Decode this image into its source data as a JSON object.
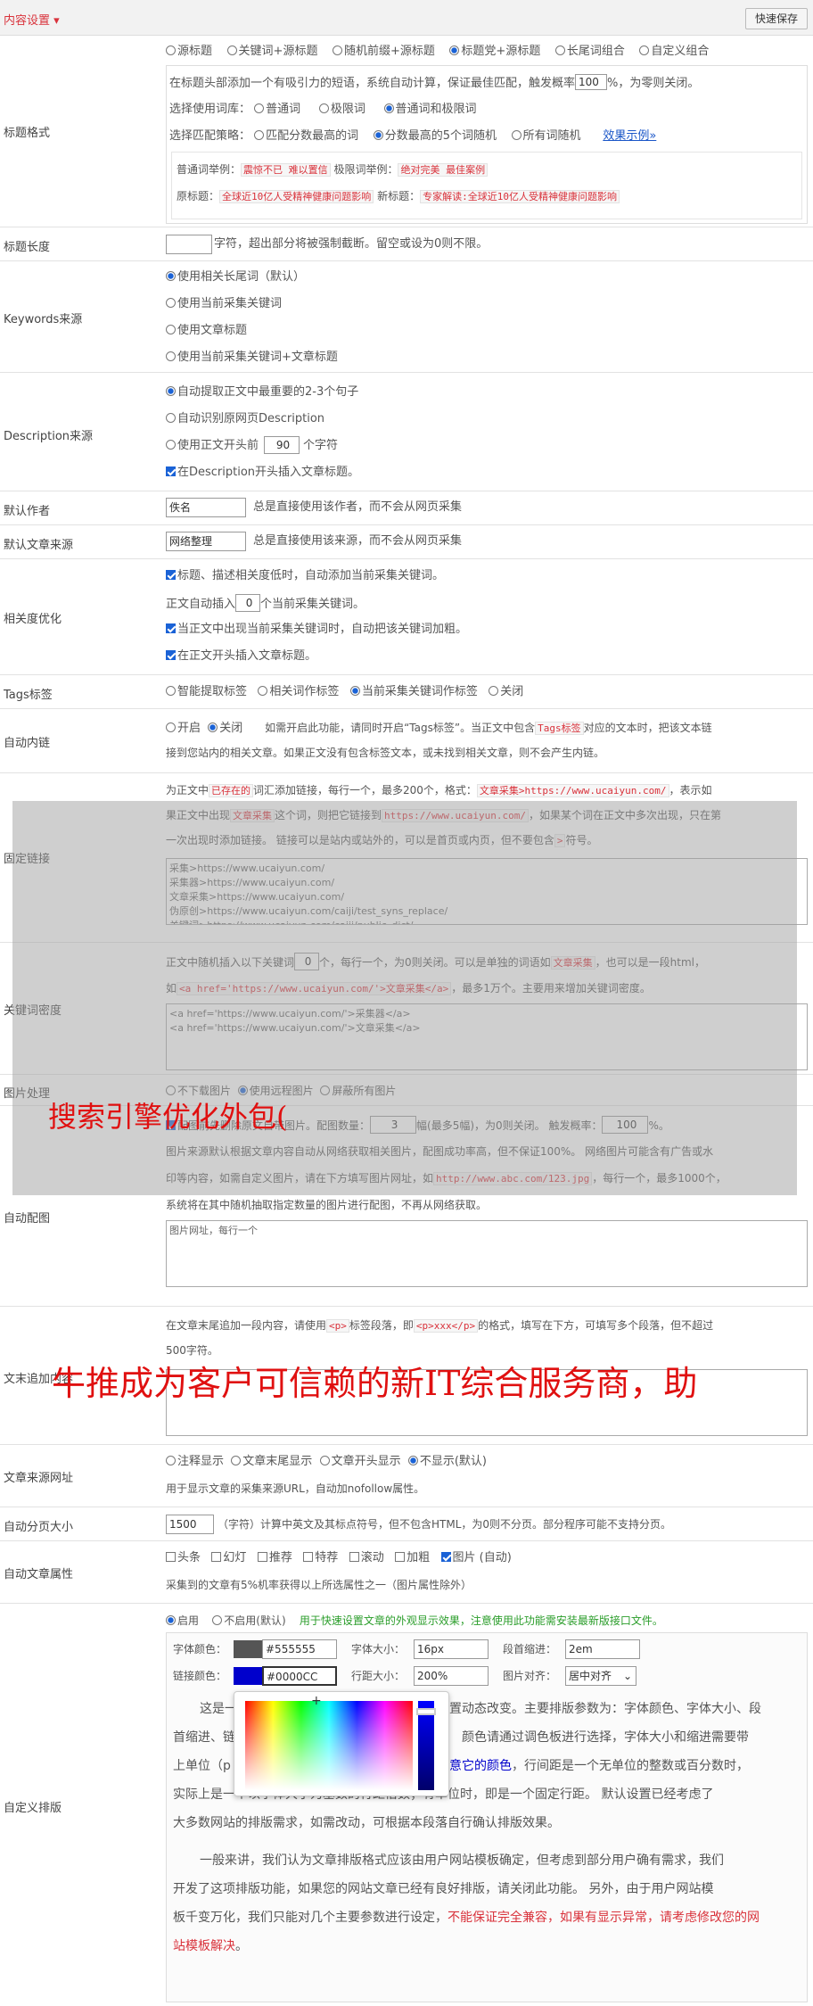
{
  "header": {
    "title": "内容设置 ▾",
    "save": "快速保存"
  },
  "title_format": {
    "label": "标题格式",
    "options": [
      "源标题",
      "关键词+源标题",
      "随机前缀+源标题",
      "标题党+源标题",
      "长尾词组合",
      "自定义组合"
    ],
    "desc_pre": "在标题头部添加一个有吸引力的短语，系统自动计算，保证最佳匹配，触发概率",
    "prob": "100",
    "desc_post": "%，为零则关闭。",
    "dict_label": "选择使用词库：",
    "dict_opts": [
      "普通词",
      "极限词",
      "普通词和极限词"
    ],
    "strategy_label": "选择匹配策略：",
    "strategy_opts": [
      "匹配分数最高的词",
      "分数最高的5个词随机",
      "所有词随机"
    ],
    "example_link": "效果示例»",
    "ex1_a": "普通词举例：",
    "ex1_b": "震惊不已 难以置信",
    "ex1_c": "极限词举例：",
    "ex1_d": "绝对完美 最佳案例",
    "ex2_a": "原标题：",
    "ex2_b": "全球近10亿人受精神健康问题影响",
    "ex2_c": "新标题：",
    "ex2_d": "专家解读:全球近10亿人受精神健康问题影响"
  },
  "title_len": {
    "label": "标题长度",
    "text": "字符，超出部分将被强制截断。留空或设为0则不限。"
  },
  "keywords": {
    "label": "Keywords来源",
    "opts": [
      "使用相关长尾词（默认）",
      "使用当前采集关键词",
      "使用文章标题",
      "使用当前采集关键词+文章标题"
    ]
  },
  "description": {
    "label": "Description来源",
    "opts": [
      "自动提取正文中最重要的2-3个句子",
      "自动识别原网页Description",
      "使用正文开头前",
      "在Description开头插入文章标题。"
    ],
    "num": "90",
    "unit": "个字符"
  },
  "author": {
    "label": "默认作者",
    "value": "佚名",
    "hint": "总是直接使用该作者，而不会从网页采集"
  },
  "source": {
    "label": "默认文章来源",
    "value": "网络整理",
    "hint": "总是直接使用该来源，而不会从网页采集"
  },
  "relevance": {
    "label": "相关度优化",
    "l1": "标题、描述相关度低时，自动添加当前采集关键词。",
    "l2a": "正文自动插入",
    "l2n": "0",
    "l2b": "个当前采集关键词。",
    "l3": "当正文中出现当前采集关键词时，自动把该关键词加粗。",
    "l4": "在正文开头插入文章标题。"
  },
  "tags": {
    "label": "Tags标签",
    "opts": [
      "智能提取标签",
      "相关词作标签",
      "当前采集关键词作标签",
      "关闭"
    ]
  },
  "auto_link": {
    "label": "自动内链",
    "opts": [
      "开启",
      "关闭"
    ],
    "t1": "如需开启此功能，请同时开启“Tags标签”。当正文中包含",
    "t1code": "Tags标签",
    "t1b": "对应的文本时，把该文本链",
    "t2": "接到您站内的相关文章。如果正文没有包含标签文本，或未找到相关文章，则不会产生内链。"
  },
  "fixed_link": {
    "label": "固定链接",
    "p1a": "为正文中",
    "p1b": "已存在的",
    "p1c": "词汇添加链接，每行一个，最多200个，格式：",
    "p1code": "文章采集>https://www.ucaiyun.com/",
    "p1d": "，表示如",
    "p2a": "果正文中出现",
    "p2code": "文章采集",
    "p2b": "这个词，则把它链接到",
    "p2code2": "https://www.ucaiyun.com/",
    "p2c": "，如果某个词在正文中多次出现，只在第",
    "p3": "一次出现时添加链接。 链接可以是站内或站外的，可以是首页或内页，但不要包含",
    "p3code": ">",
    "p3b": "符号。",
    "textarea": "采集>https://www.ucaiyun.com/\n采集器>https://www.ucaiyun.com/\n文章采集>https://www.ucaiyun.com/\n伪原创>https://www.ucaiyun.com/caiji/test_syns_replace/\n关键词>https://www.ucaiyun.com/caiji/public_dict/"
  },
  "density": {
    "label": "关键词密度",
    "p1a": "正文中随机插入以下关键词",
    "n": "0",
    "p1b": "个，每行一个，为0则关闭。可以是单独的词语如",
    "p1code": "文章采集",
    "p1c": "，也可以是一段html，",
    "p2a": "如",
    "p2code": "<a href='https://www.ucaiyun.com/'>文章采集</a>",
    "p2b": "，最多1万个。主要用来增加关键词密度。",
    "textarea": "<a href='https://www.ucaiyun.com/'>采集器</a>\n<a href='https://www.ucaiyun.com/'>文章采集</a>"
  },
  "image": {
    "label": "图片处理",
    "opts": [
      "不下载图片",
      "使用远程图片",
      "屏蔽所有图片"
    ]
  },
  "auto_img": {
    "label": "自动配图",
    "l1a": "配图前先删除原文自带图片。配图数量：",
    "num": "3",
    "l1b": "幅(最多5幅)，为0则关闭。 触发概率：",
    "prob": "100",
    "l1c": "%。",
    "l2": "图片来源默认根据文章内容自动从网络获取相关图片，配图成功率高，但不保证100%。 网络图片可能含有广告或水",
    "l3a": "印等内容，如需自定义图片，请在下方填写图片网址，如",
    "l3code": "http://www.abc.com/123.jpg",
    "l3b": "，每行一个，最多1000个，",
    "l4": "系统将在其中随机抽取指定数量的图片进行配图，不再从网络获取。",
    "placeholder": "图片网址，每行一个"
  },
  "tail": {
    "label": "文末追加内容",
    "l1a": "在文章末尾追加一段内容，请使用",
    "code1": "<p>",
    "l1b": "标签段落，即",
    "code2": "<p>xxx</p>",
    "l1c": "的格式，填写在下方，可填写多个段落，但不超过",
    "l2": "500字符。"
  },
  "src_url": {
    "label": "文章来源网址",
    "opts": [
      "注释显示",
      "文章末尾显示",
      "文章开头显示",
      "不显示(默认)"
    ],
    "hint": "用于显示文章的采集来源URL，自动加nofollow属性。"
  },
  "paging": {
    "label": "自动分页大小",
    "value": "1500",
    "text": "（字符）计算中英文及其标点符号，但不包含HTML，为0则不分页。部分程序可能不支持分页。"
  },
  "attrs": {
    "label": "自动文章属性",
    "opts": [
      "头条",
      "幻灯",
      "推荐",
      "特荐",
      "滚动",
      "加粗",
      "图片 (自动)"
    ],
    "hint": "采集到的文章有5%机率获得以上所选属性之一（图片属性除外）"
  },
  "layout": {
    "label": "自定义排版",
    "opts": [
      "启用",
      "不启用(默认)"
    ],
    "note": "用于快速设置文章的外观显示效果，注意使用此功能需安装最新版接口文件。",
    "font_color_l": "字体颜色：",
    "font_color": "#555555",
    "font_size_l": "字体大小：",
    "font_size": "16px",
    "indent_l": "段首缩进：",
    "indent": "2em",
    "link_color_l": "链接颜色：",
    "link_color": "#0000CC",
    "line_h_l": "行距大小：",
    "line_h": "200%",
    "img_align_l": "图片对齐：",
    "img_align": "居中对齐",
    "p1a": "这是一",
    "p1b": "置动态改变。主要排版参数为：字体颜色、字体大小、段",
    "p2a": "首缩进、链",
    "p2b": "颜色请通过调色板进行选择，字体大小和缩进需要带",
    "p3a": "上单位（p",
    "p3b": "意它的颜色",
    "p3c": "，行间距是一个无单位的整数或百分数时，",
    "p4": "实际上是一个以字体大小为基数的行距倍数；有单位时，即是一个固定行距。 默认设置已经考虑了",
    "p5": "大多数网站的排版需求，如需改动，可根据本段落自行确认排版效果。",
    "q1": "一般来讲，我们认为文章排版格式应该由用户网站模板确定，但考虑到部分用户确有需求，我们",
    "q2": "开发了这项排版功能，如果您的网站文章已经有良好排版，请关闭此功能。 另外，由于用户网站模",
    "q3a": "板千变万化，我们只能对几个主要参数进行设定，",
    "q3b": "不能保证完全兼容，如果有显示异常，请考虑修改您的网",
    "q4a": "站模板解决",
    "q4b": "。"
  },
  "overlay": {
    "text1": "搜索引擎优化外包(",
    "text2": "牛推成为客户可信赖的新IT综合服务商，助"
  },
  "colors": {
    "accent": "#d9323b",
    "link": "#1a56c8",
    "green": "#2a9d2a"
  }
}
